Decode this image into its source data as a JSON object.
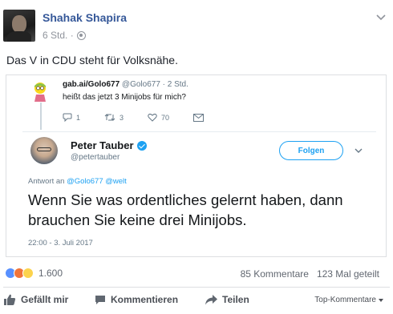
{
  "post": {
    "author": "Shahak Shapira",
    "time": "6 Std. ·",
    "text": "Das V in CDU steht für Volksnähe."
  },
  "embedded_tweet": {
    "reply": {
      "account": "gab.ai/Golo677",
      "handle_time": "@Golo677 · 2 Std.",
      "text": "heißt das jetzt 3 Minijobs für mich?",
      "replies": "1",
      "retweets": "3",
      "likes": "70"
    },
    "main": {
      "name": "Peter Tauber",
      "handle": "@petertauber",
      "follow_label": "Folgen",
      "reply_to_prefix": "Antwort an",
      "reply_to_links": "@Golo677 @welt",
      "text": "Wenn Sie was ordentliches gelernt haben, dann brauchen Sie keine drei Minijobs.",
      "date": "22:00 - 3. Juli 2017"
    }
  },
  "engagement": {
    "reaction_count": "1.600",
    "comments": "85 Kommentare",
    "shares": "123 Mal geteilt"
  },
  "actions": {
    "like_label": "Gefällt mir",
    "comment_label": "Kommentieren",
    "share_label": "Teilen",
    "sort_label": "Top-Kommentare"
  },
  "colors": {
    "author_link": "#365899",
    "twitter_blue": "#1da1f2",
    "like_blue": "#5890ff"
  },
  "icons": [
    "globe-icon",
    "chevron-down-icon",
    "reply-icon",
    "retweet-icon",
    "heart-icon",
    "dm-icon",
    "verified-icon",
    "like-thumb-icon",
    "comment-icon",
    "share-icon"
  ]
}
